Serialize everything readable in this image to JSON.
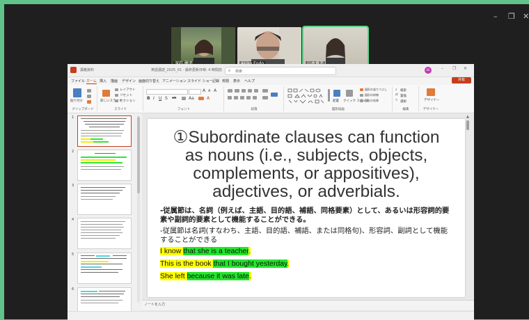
{
  "meeting": {
    "participants": [
      {
        "name": "深石 麗子"
      },
      {
        "name": "Akiko Endo"
      },
      {
        "name": "山本恵子"
      }
    ],
    "window_controls": [
      "–",
      "❐",
      "✕"
    ]
  },
  "ppt": {
    "title_text": "講義資料",
    "filename_text": "英語講読_2025_01 · 最終更新日時: 4 時間前",
    "search_placeholder": "検索",
    "user_initials": "AE",
    "menu": [
      "ファイル",
      "ホーム",
      "挿入",
      "描画",
      "デザイン",
      "画面切り替え",
      "アニメーション",
      "スライド ショー",
      "記録",
      "校閲",
      "表示",
      "ヘルプ"
    ],
    "share_label": "共有",
    "ribbon_groups": [
      "クリップボード",
      "スライド",
      "フォント",
      "段落",
      "図形描画",
      "編集",
      "デザイナー"
    ],
    "ribbon_buttons": {
      "paste": "貼り付け",
      "new_slide": "新しいスライド",
      "layout": "レイアウト",
      "reset": "リセット",
      "section": "セクション",
      "arrange": "配置",
      "quick_styles": "クイック スタイル",
      "find": "検索",
      "replace": "置換",
      "select": "選択",
      "designer": "デザイナー",
      "shape_fill": "図形の塗りつぶし",
      "shape_outline": "図形の枠線",
      "shape_effects": "図形の効果"
    },
    "slide_numbers": [
      "1",
      "2",
      "3",
      "4",
      "5",
      "6"
    ],
    "notes_placeholder": "ノートを入力"
  },
  "slide": {
    "title_lines": [
      "①Subordinate clauses can function",
      "as nouns (i.e., subjects, objects,",
      "complements, or appositives),",
      "adjectives, or adverbials."
    ],
    "jp_bold": "-従属節は、名詞（例えば、主語、目的語、補語、同格要素）として、あるいは形容詞的要素や副詞的要素として機能することができる。",
    "jp_regular": "-従属節は名詞(すなわち、主語、目的語、補語、または同格句)、形容詞、副詞として機能することができる",
    "examples": [
      {
        "pre": "I know ",
        "clause": "that she is a teacher",
        "post": "."
      },
      {
        "pre": "This is the book ",
        "clause": "that I bought yesterday",
        "post": "."
      },
      {
        "pre": "She left ",
        "clause": "because it was late",
        "post": "."
      }
    ]
  },
  "colors": {
    "highlight_yellow": "#ffff00",
    "highlight_green": "#22e62a",
    "ppt_accent": "#c43e1c",
    "meeting_border": "#5fc38a"
  }
}
